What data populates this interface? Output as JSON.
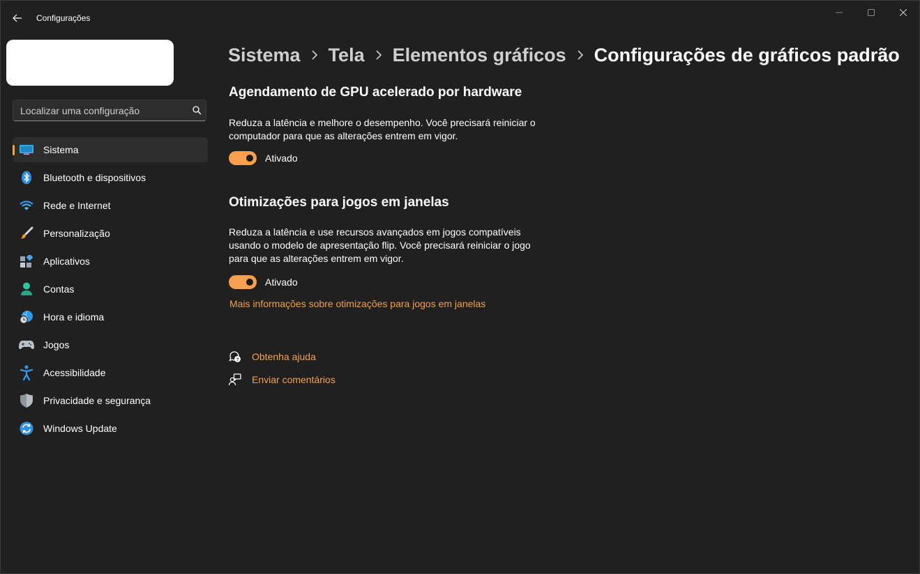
{
  "window": {
    "title": "Configurações"
  },
  "search": {
    "placeholder": "Localizar uma configuração"
  },
  "sidebar": {
    "items": [
      {
        "label": "Sistema",
        "icon": "monitor-icon"
      },
      {
        "label": "Bluetooth e dispositivos",
        "icon": "bluetooth-icon"
      },
      {
        "label": "Rede e Internet",
        "icon": "wifi-icon"
      },
      {
        "label": "Personalização",
        "icon": "brush-icon"
      },
      {
        "label": "Aplicativos",
        "icon": "apps-icon"
      },
      {
        "label": "Contas",
        "icon": "person-icon"
      },
      {
        "label": "Hora e idioma",
        "icon": "globe-clock-icon"
      },
      {
        "label": "Jogos",
        "icon": "gamepad-icon"
      },
      {
        "label": "Acessibilidade",
        "icon": "accessibility-icon"
      },
      {
        "label": "Privacidade e segurança",
        "icon": "shield-icon"
      },
      {
        "label": "Windows Update",
        "icon": "update-icon"
      }
    ],
    "selected": "Sistema"
  },
  "breadcrumb": {
    "items": [
      "Sistema",
      "Tela",
      "Elementos gráficos",
      "Configurações de gráficos padrão"
    ]
  },
  "sections": [
    {
      "title": "Agendamento de GPU acelerado por hardware",
      "description": "Reduza a latência e melhore o desempenho. Você precisará reiniciar o computador para que as alterações entrem em vigor.",
      "toggle_state": "Ativado",
      "toggle_on": true
    },
    {
      "title": "Otimizações para jogos em janelas",
      "description": "Reduza a latência e use recursos avançados em jogos compatíveis usando o modelo de apresentação flip. Você precisará reiniciar o jogo para que as alterações entrem em vigor.",
      "toggle_state": "Ativado",
      "toggle_on": true,
      "link": "Mais informações sobre otimizações para jogos em janelas"
    }
  ],
  "help": {
    "get_help": "Obtenha ajuda",
    "feedback": "Enviar comentários"
  },
  "colors": {
    "accent": "#f2a14d",
    "background": "#202020"
  }
}
